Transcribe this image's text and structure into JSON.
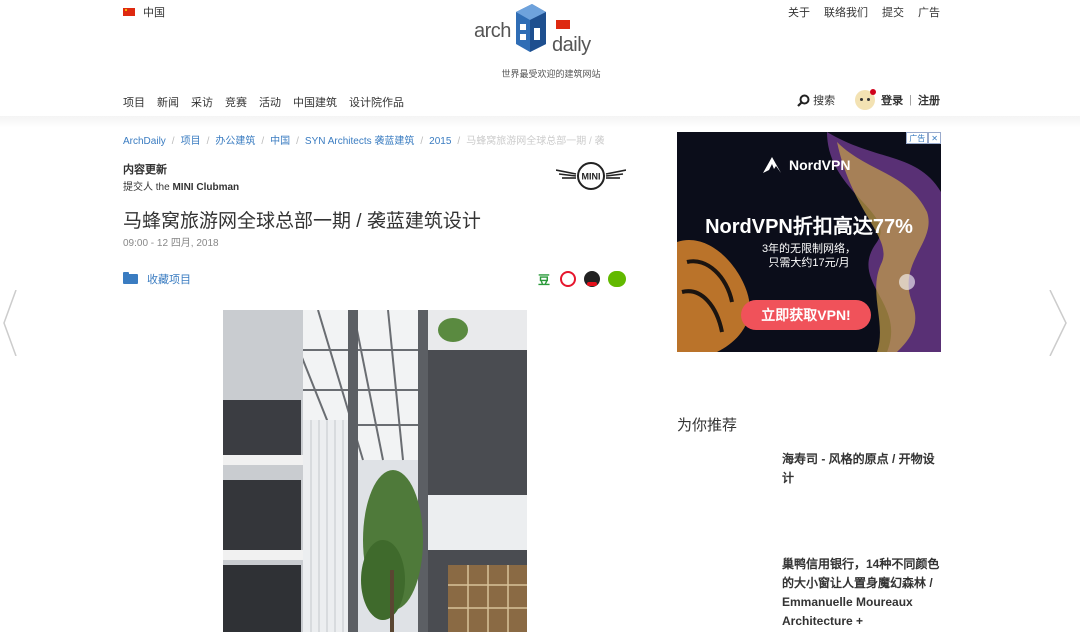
{
  "top": {
    "region": "中国",
    "links": [
      "关于",
      "联络我们",
      "提交",
      "广告"
    ]
  },
  "logo": {
    "arch": "arch",
    "daily": "daily",
    "tagline": "世界最受欢迎的建筑网站"
  },
  "nav": {
    "items": [
      "项目",
      "新闻",
      "采访",
      "竞赛",
      "活动",
      "中国建筑",
      "设计院作品"
    ],
    "search": "搜索",
    "login": "登录",
    "separator": "|",
    "register": "注册"
  },
  "breadcrumb": [
    "ArchDaily",
    "项目",
    "办公建筑",
    "中国",
    "SYN Architects 袭蓝建筑",
    "2015",
    "马蜂窝旅游网全球总部一期 / 袭"
  ],
  "article": {
    "update_label": "内容更新",
    "submitted_by": "提交人 the",
    "submitter": "MINI Clubman",
    "sponsor_logo_text": "MINI",
    "title": "马蜂窝旅游网全球总部一期 / 袭蓝建筑设计",
    "date": "09:00 - 12 四月, 2018",
    "collect_label": "收藏项目",
    "share_icons": [
      "douban-icon",
      "weibo-icon",
      "qq-icon",
      "wechat-icon"
    ],
    "douban_glyph": "豆"
  },
  "ad": {
    "badge": "广告",
    "close": "✕",
    "brand": "NordVPN",
    "headline": "NordVPN折扣高达77%",
    "sub1": "3年的无限制网络，",
    "sub2": "只需大约17元/月",
    "cta": "立即获取VPN!"
  },
  "recommend": {
    "title": "为你推荐",
    "items": [
      "海寿司 - 风格的原点 / 开物设计",
      "巢鸭信用银行，14种不同颜色的大小窗让人置身魔幻森林 / Emmanuelle Moureaux Architecture +"
    ]
  },
  "colors": {
    "link_blue": "#3a7cc1",
    "ad_cta": "#f0525a",
    "flag_red": "#de2910"
  }
}
